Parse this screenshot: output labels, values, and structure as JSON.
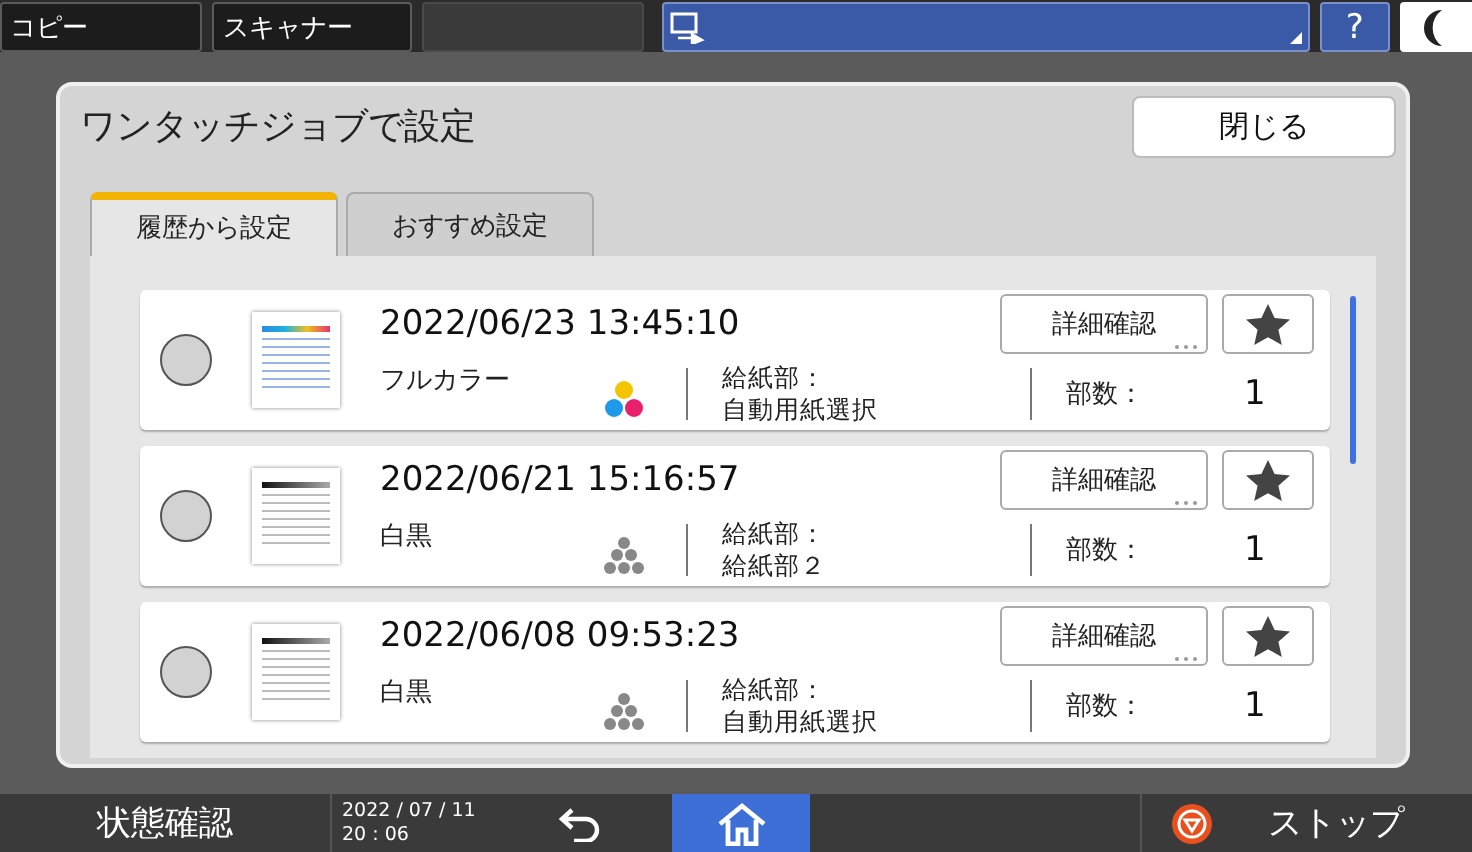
{
  "top_bar": {
    "apps": [
      "コピー",
      "スキャナー"
    ],
    "help": "?"
  },
  "dialog": {
    "title": "ワンタッチジョブで設定",
    "close": "閉じる",
    "tabs": [
      {
        "label": "履歴から設定",
        "selected": true
      },
      {
        "label": "おすすめ設定",
        "selected": false
      }
    ],
    "jobs": [
      {
        "selected": false,
        "kind": "color",
        "datetime": "2022/06/23 13:45:10",
        "color_mode": "フルカラー",
        "tray_label": "給紙部：",
        "tray": "自動用紙選択",
        "copies_label": "部数：",
        "copies": "1",
        "detail": "詳細確認"
      },
      {
        "selected": false,
        "kind": "mono",
        "datetime": "2022/06/21 15:16:57",
        "color_mode": "白黒",
        "tray_label": "給紙部：",
        "tray": "給紙部２",
        "copies_label": "部数：",
        "copies": "1",
        "detail": "詳細確認"
      },
      {
        "selected": false,
        "kind": "mono",
        "datetime": "2022/06/08 09:53:23",
        "color_mode": "白黒",
        "tray_label": "給紙部：",
        "tray": "自動用紙選択",
        "copies_label": "部数：",
        "copies": "1",
        "detail": "詳細確認"
      }
    ]
  },
  "bottom_bar": {
    "status": "状態確認",
    "date": "2022 / 07 / 11",
    "time": "20 : 06",
    "stop": "ストップ"
  }
}
